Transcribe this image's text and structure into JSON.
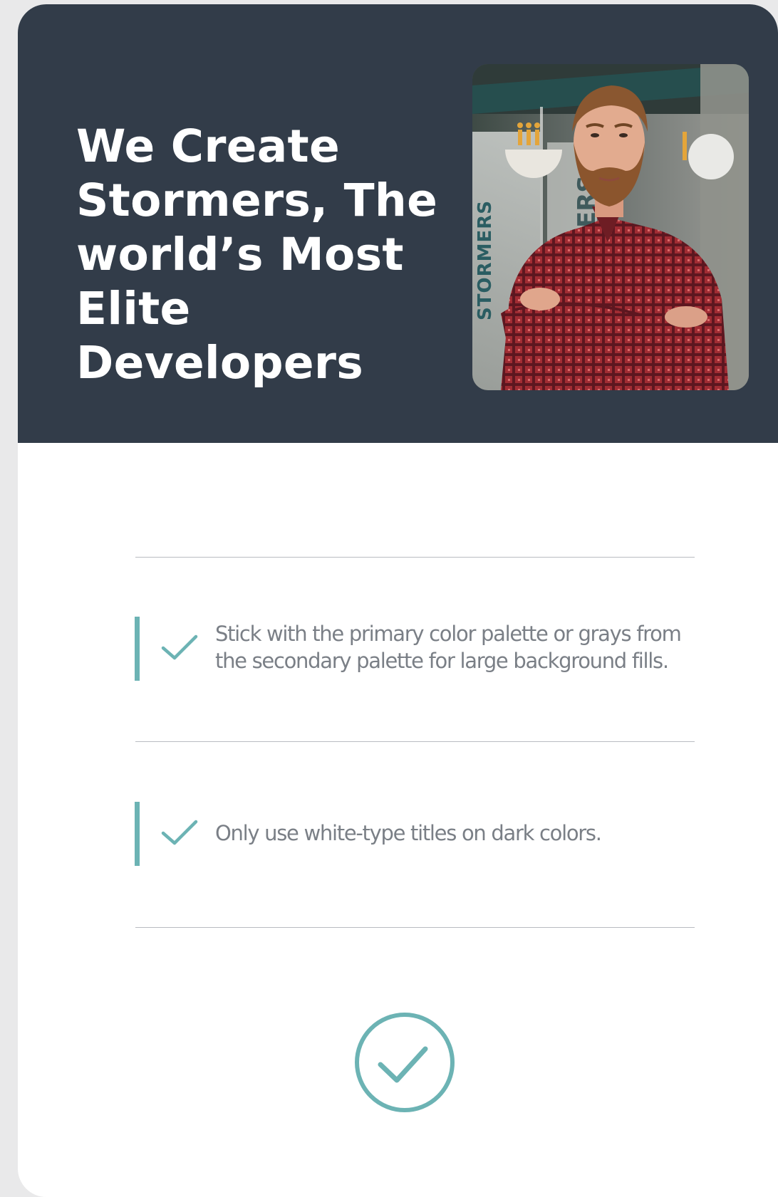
{
  "hero": {
    "title": "We Create Stormers, The world’s Most Elite Developers",
    "photo_sign_text_left": "STORMERS",
    "photo_sign_text_right": "ERS"
  },
  "guidelines": [
    {
      "text": "Stick with the primary color palette or grays from the secondary palette for large background fills.",
      "icon": "check-icon"
    },
    {
      "text": "Only use white-type titles on dark colors.",
      "icon": "check-icon"
    }
  ],
  "footer": {
    "icon": "check-circle-icon"
  },
  "colors": {
    "hero_background": "#323c49",
    "accent": "#6cb3b4",
    "body_text": "#7a7f86",
    "divider": "#b9bcc1"
  }
}
